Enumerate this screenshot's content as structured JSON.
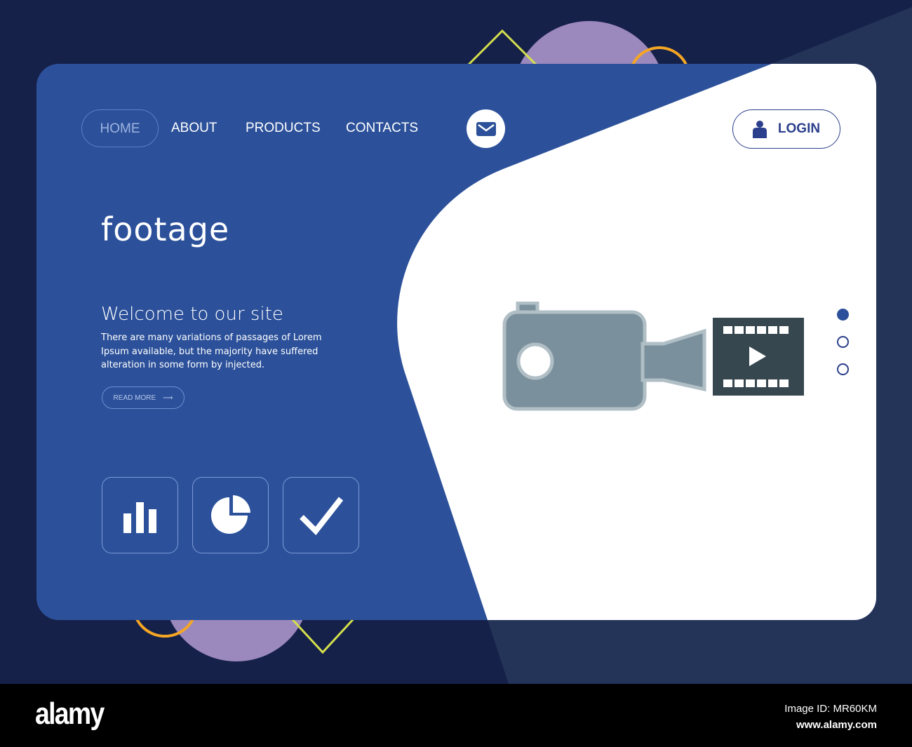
{
  "nav": {
    "items": [
      "HOME",
      "ABOUT",
      "PRODUCTS",
      "CONTACTS"
    ],
    "login": "LOGIN"
  },
  "hero": {
    "title": "footage",
    "welcome": "Welcome to our site",
    "description": "There are many variations of passages of Lorem Ipsum available, but the majority have suffered alteration in some form by injected.",
    "read_more": "READ MORE"
  },
  "icons": [
    "bar-chart-icon",
    "pie-chart-icon",
    "check-icon",
    "mail-icon",
    "user-icon",
    "video-camera-icon",
    "film-play-icon"
  ],
  "slider": {
    "count": 3,
    "active": 0
  },
  "footer": {
    "logo": "alamy",
    "image_id": "Image ID: MR60KM",
    "url": "www.alamy.com"
  },
  "colors": {
    "background": "#16214a",
    "card": "#2c519a",
    "accent": "#2b3f8c",
    "purple": "#9b88bd",
    "yellow": "#d4e04a",
    "orange": "#f5a623"
  }
}
